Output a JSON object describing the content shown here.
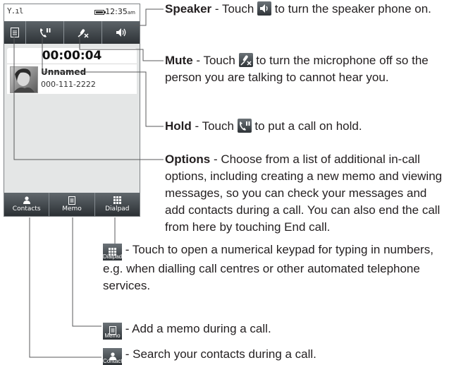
{
  "phone": {
    "status": {
      "signal": "Y.ıl",
      "time": "12:35",
      "time_suffix": "am"
    },
    "toolbar": {
      "options_icon": "menu-icon",
      "hold_icon": "hold-phone-icon",
      "mute_icon": "mic-off-icon",
      "speaker_icon": "speaker-icon"
    },
    "call": {
      "timer": "00:00:04",
      "name": "Unnamed",
      "number": "000-111-2222"
    },
    "bottom": {
      "contacts": "Contacts",
      "memo": "Memo",
      "dialpad": "Dialpad"
    }
  },
  "descriptions": {
    "speaker": {
      "title": "Speaker",
      "pre": " - Touch ",
      "post": " to turn the speaker phone on."
    },
    "mute": {
      "title": "Mute",
      "pre": " - Touch ",
      "post": " to turn the microphone off so the person you are talking to cannot hear you."
    },
    "hold": {
      "title": "Hold",
      "pre": " - Touch ",
      "post": " to put a call on hold."
    },
    "options": {
      "title": "Options",
      "text": " - Choose from a list of additional in-call options, including creating a new memo and viewing messages, so you can check your messages and add contacts during a call. You can also end the call from here by touching End call."
    },
    "dialpad": {
      "icon_label": "Dialpad",
      "text": " - Touch to open a numerical keypad for typing in numbers, e.g. when dialling call centres or other automated telephone services."
    },
    "memo": {
      "icon_label": "Memo",
      "text": " - Add a memo during a call."
    },
    "contacts": {
      "icon_label": "Contacts",
      "text": " - Search your contacts during a call."
    }
  },
  "colors": {
    "toolbar": "#3f4549",
    "screen": "#e4e6e6",
    "text": "#231f20",
    "line": "#58595b"
  }
}
